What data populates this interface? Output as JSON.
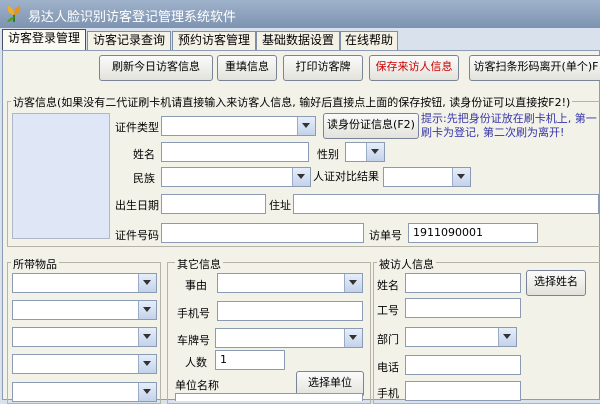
{
  "app": {
    "title": "易达人脸识别访客登记管理系统软件",
    "icon": "app-logo-icon"
  },
  "tabs": [
    "访客登录管理",
    "访客记录查询",
    "预约访客管理",
    "基础数据设置",
    "在线帮助"
  ],
  "toolbar": {
    "refresh": "刷新今日访客信息",
    "refill": "重填信息",
    "print": "打印访客牌",
    "save": "保存来访人信息",
    "scan_exit": "访客扫条形码离开(单个)F"
  },
  "visitor": {
    "group_label": "访客信息(如果没有二代证刷卡机请直接输入来访客人信息, 输好后直接点上面的保存按钮, 读身份证可以直接按F2!)",
    "id_type_label": "证件类型",
    "read_id_button": "读身份证信息(F2)",
    "hint_line1": "提示:先把身份证放在刷卡机上, 第一",
    "hint_line2": "刷卡为登记, 第二次刷为离开!",
    "name_label": "姓名",
    "gender_label": "性别",
    "ethnicity_label": "民族",
    "face_result_label": "人证对比结果",
    "birth_label": "出生日期",
    "address_label": "住址",
    "id_number_label": "证件号码",
    "visit_no_label": "访单号",
    "visit_no_value": "1911090001"
  },
  "belongings": {
    "group_label": "所带物品"
  },
  "other": {
    "group_label": "其它信息",
    "reason_label": "事由",
    "phone_label": "手机号",
    "plate_label": "车牌号",
    "count_label": "人数",
    "count_value": "1",
    "unit_label": "单位名称",
    "select_unit_button": "选择单位"
  },
  "host": {
    "group_label": "被访人信息",
    "name_label": "姓名",
    "select_name_button": "选择姓名",
    "empno_label": "工号",
    "dept_label": "部门",
    "tel_label": "电话",
    "mobile_label": "手机"
  },
  "colors": {
    "save_text": "#cc0000",
    "hint_text": "#3636a8",
    "titlebar": "#8aa0bd"
  }
}
